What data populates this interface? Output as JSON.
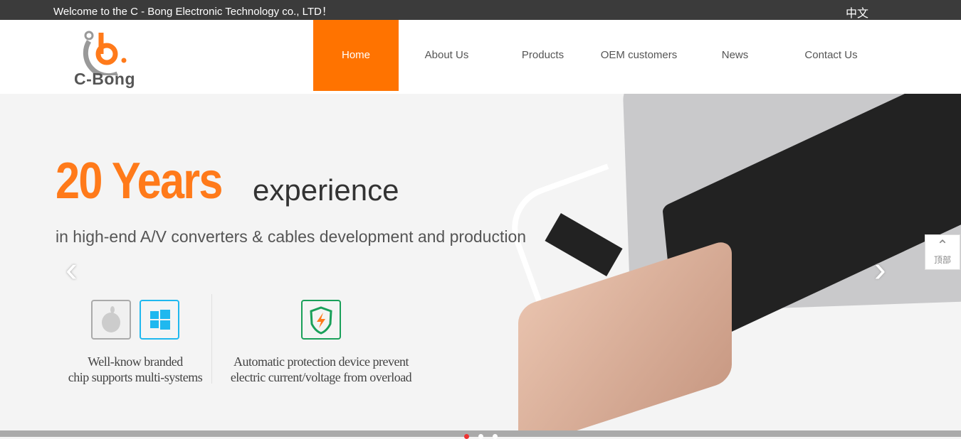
{
  "topbar": {
    "welcome": "Welcome to the C - Bong Electronic Technology co., LTD！",
    "language": "中文"
  },
  "logo": {
    "text": "C-Bong"
  },
  "nav": [
    {
      "label": "Home",
      "active": true
    },
    {
      "label": "About Us"
    },
    {
      "label": "Products"
    },
    {
      "label": "OEM customers"
    },
    {
      "label": "News"
    },
    {
      "label": "Contact Us"
    }
  ],
  "banner": {
    "headline_big": "20 Years",
    "headline_rest": "experience",
    "subtitle": "in high-end A/V converters & cables development and production",
    "features": [
      {
        "line1": "Well-know branded",
        "line2": "chip supports multi-systems",
        "icons": [
          "apple-icon",
          "windows-icon"
        ]
      },
      {
        "line1": "Automatic protection device prevent",
        "line2": "electric current/voltage from overload",
        "icons": [
          "shield-lightning-icon"
        ]
      }
    ]
  },
  "back_to_top": "顶部",
  "colors": {
    "accent": "#ff7300",
    "topbar": "#3b3b3b",
    "windows": "#1fb8ef",
    "shield": "#1aa05a"
  }
}
